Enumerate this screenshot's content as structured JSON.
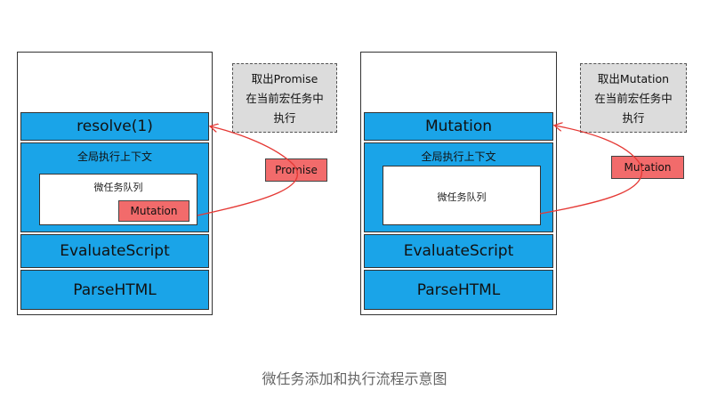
{
  "left": {
    "top_block": "resolve(1)",
    "context_title": "全局执行上下文",
    "queue_label": "微任务队列",
    "queue_item": "Mutation",
    "evaluate": "EvaluateScript",
    "parse": "ParseHTML",
    "arrow_tag": "Promise",
    "note": [
      "取出Promise",
      "在当前宏任务中",
      "执行"
    ]
  },
  "right": {
    "top_block": "Mutation",
    "context_title": "全局执行上下文",
    "queue_label": "微任务队列",
    "evaluate": "EvaluateScript",
    "parse": "ParseHTML",
    "arrow_tag": "Mutation",
    "note": [
      "取出Mutation",
      "在当前宏任务中",
      "执行"
    ]
  },
  "caption": "微任务添加和执行流程示意图",
  "colors": {
    "block": "#1aa4e8",
    "tag": "#f26b6b",
    "note": "#dcdcdc",
    "arrow": "#e53935"
  }
}
